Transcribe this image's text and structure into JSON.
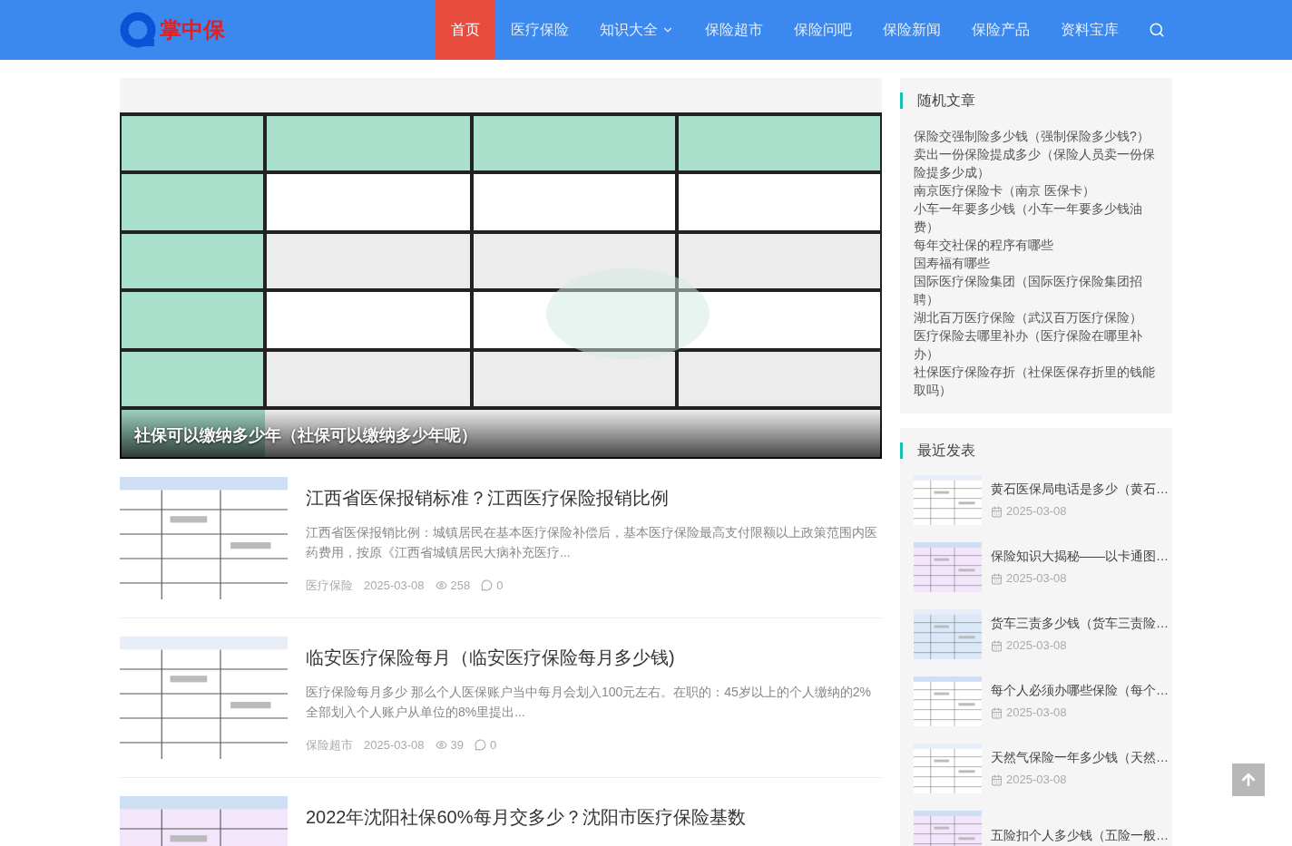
{
  "nav": {
    "logo": "掌中保",
    "items": [
      {
        "label": "首页",
        "selected": true,
        "dropdown": false
      },
      {
        "label": "医疗保险",
        "selected": false,
        "dropdown": false
      },
      {
        "label": "知识大全",
        "selected": false,
        "dropdown": true
      },
      {
        "label": "保险超市",
        "selected": false,
        "dropdown": false
      },
      {
        "label": "保险问吧",
        "selected": false,
        "dropdown": false
      },
      {
        "label": "保险新闻",
        "selected": false,
        "dropdown": false
      },
      {
        "label": "保险产品",
        "selected": false,
        "dropdown": false
      },
      {
        "label": "资料宝库",
        "selected": false,
        "dropdown": false
      }
    ]
  },
  "hero": {
    "kind": "picture",
    "caption": "社保可以缴纳多少年（社保可以缴纳多少年呢）"
  },
  "articles": [
    {
      "title": "江西省医保报销标准？江西医疗保险报销比例",
      "excerpt": "江西省医保报销比例：城镇居民在基本医疗保险补偿后，基本医疗保险最高支付限额以上政策范围内医药费用，按原《江西省城镇居民大病补充医疗...",
      "category": "医疗保险",
      "date": "2025-03-08",
      "views": "258",
      "comments": "0"
    },
    {
      "title": "临安医疗保险每月（临安医疗保险每月多少钱)",
      "excerpt": "医疗保险每月多少 那么个人医保账户当中每月会划入100元左右。在职的：45岁以上的个人缴纳的2%全部划入个人账户从单位的8%里提出...",
      "category": "保险超市",
      "date": "2025-03-08",
      "views": "39",
      "comments": "0"
    },
    {
      "title": "2022年沈阳社保60%每月交多少？沈阳市医疗保险基数"
    }
  ],
  "sidebar": {
    "random": {
      "title": "随机文章",
      "links": [
        "保险交强制险多少钱（强制保险多少钱?）",
        "卖出一份保险提成多少（保险人员卖一份保险提多少成）",
        "南京医疗保险卡（南京 医保卡）",
        "小车一年要多少钱（小车一年要多少钱油费）",
        "每年交社保的程序有哪些",
        "国寿福有哪些",
        "国际医疗保险集团（国际医疗保险集团招聘）",
        "湖北百万医疗保险（武汉百万医疗保险）",
        "医疗保险去哪里补办（医疗保险在哪里补办）",
        "社保医疗保险存折（社保医保存折里的钱能取吗）"
      ]
    },
    "recent": {
      "title": "最近发表",
      "posts": [
        {
          "title": "黄石医保局电话是多少（黄石…",
          "date": "2025-03-08"
        },
        {
          "title": "保险知识大揭秘——以卡通图…",
          "date": "2025-03-08"
        },
        {
          "title": "货车三责多少钱（货车三责险…",
          "date": "2025-03-08"
        },
        {
          "title": "每个人必须办哪些保险（每个…",
          "date": "2025-03-08"
        },
        {
          "title": "天然气保险一年多少钱（天然…",
          "date": "2025-03-08"
        },
        {
          "title": "五险扣个人多少钱（五险一般…"
        }
      ]
    }
  }
}
